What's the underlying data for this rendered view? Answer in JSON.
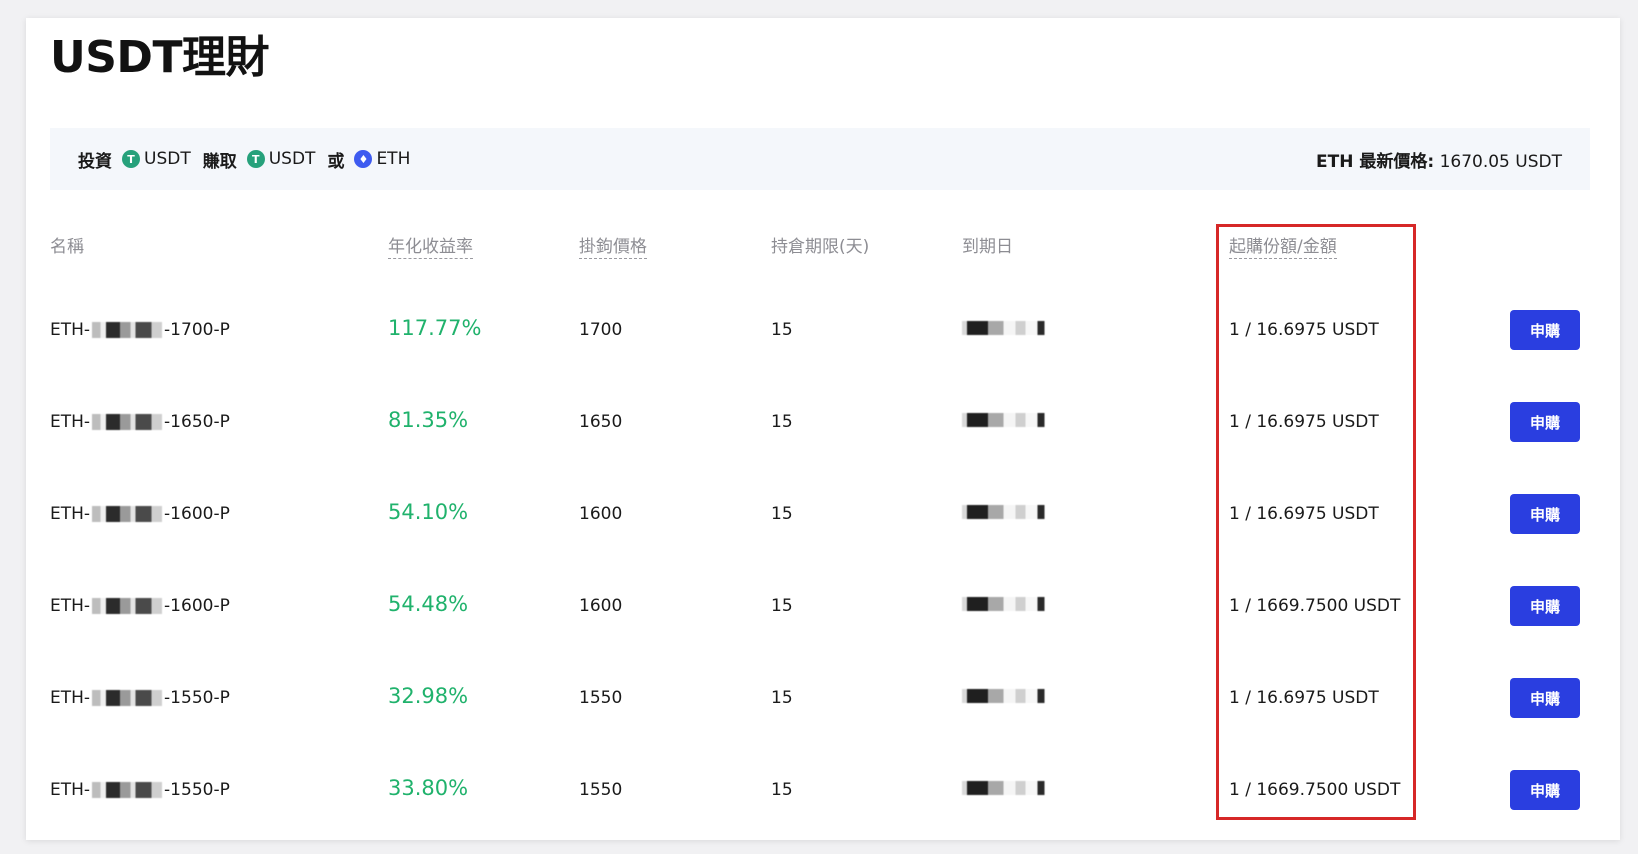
{
  "page": {
    "title": "USDT理財"
  },
  "banner": {
    "invest_label": "投資",
    "invest_coin": "USDT",
    "earn_label": "賺取",
    "earn_coin_1": "USDT",
    "or_label": "或",
    "earn_coin_2": "ETH",
    "price_label": "ETH 最新價格:",
    "price_value": "1670.05 USDT",
    "usdt_icon_glyph": "T",
    "eth_icon_glyph": "♦"
  },
  "table": {
    "headers": {
      "name": "名稱",
      "apr": "年化收益率",
      "strike": "掛鉤價格",
      "period": "持倉期限(天)",
      "expiry": "到期日",
      "min": "起購份額/金額"
    },
    "rows": [
      {
        "name_prefix": "ETH-",
        "name_suffix": "-1700-P",
        "apr": "117.77%",
        "strike": "1700",
        "period": "15",
        "min": "1 / 16.6975 USDT",
        "action": "申購"
      },
      {
        "name_prefix": "ETH-",
        "name_suffix": "-1650-P",
        "apr": "81.35%",
        "strike": "1650",
        "period": "15",
        "min": "1 / 16.6975 USDT",
        "action": "申購"
      },
      {
        "name_prefix": "ETH-",
        "name_suffix": "-1600-P",
        "apr": "54.10%",
        "strike": "1600",
        "period": "15",
        "min": "1 / 16.6975 USDT",
        "action": "申購"
      },
      {
        "name_prefix": "ETH-",
        "name_suffix": "-1600-P",
        "apr": "54.48%",
        "strike": "1600",
        "period": "15",
        "min": "1 / 1669.7500 USDT",
        "action": "申購"
      },
      {
        "name_prefix": "ETH-",
        "name_suffix": "-1550-P",
        "apr": "32.98%",
        "strike": "1550",
        "period": "15",
        "min": "1 / 16.6975 USDT",
        "action": "申購"
      },
      {
        "name_prefix": "ETH-",
        "name_suffix": "-1550-P",
        "apr": "33.80%",
        "strike": "1550",
        "period": "15",
        "min": "1 / 1669.7500 USDT",
        "action": "申購"
      }
    ]
  },
  "colors": {
    "apr_green": "#20b26c",
    "button_blue": "#2a3ee0",
    "highlight_red": "#d62828",
    "usdt_green": "#26a17b",
    "eth_blue": "#3e5bf0"
  }
}
